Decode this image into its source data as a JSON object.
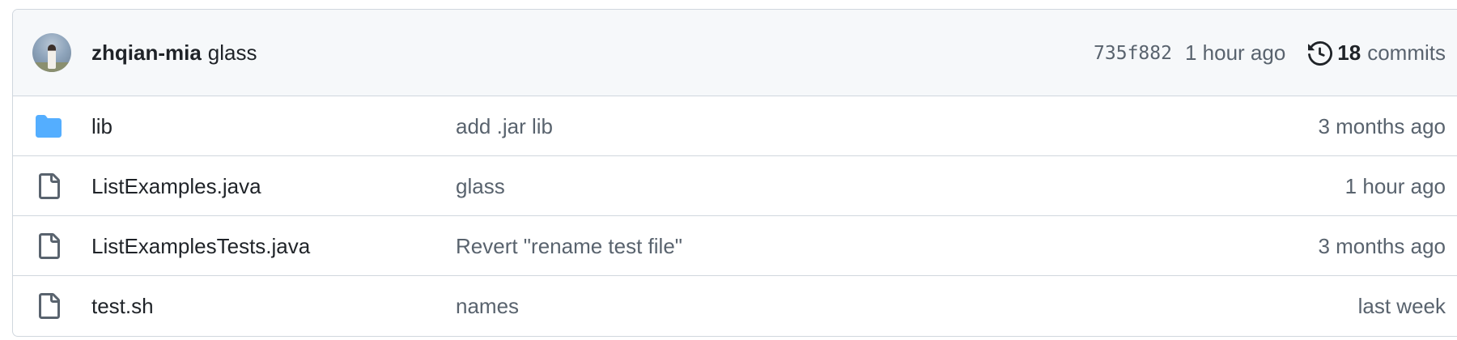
{
  "latest_commit": {
    "author": "zhqian-mia",
    "message": "glass",
    "sha": "735f882",
    "time": "1 hour ago",
    "commit_count": "18",
    "commits_label": "commits"
  },
  "files": [
    {
      "type": "folder",
      "icon": "folder-icon",
      "name": "lib",
      "message": "add .jar lib",
      "age": "3 months ago"
    },
    {
      "type": "file",
      "icon": "file-icon",
      "name": "ListExamples.java",
      "message": "glass",
      "age": "1 hour ago"
    },
    {
      "type": "file",
      "icon": "file-icon",
      "name": "ListExamplesTests.java",
      "message": "Revert \"rename test file\"",
      "age": "3 months ago"
    },
    {
      "type": "file",
      "icon": "file-icon",
      "name": "test.sh",
      "message": "names",
      "age": "last week"
    }
  ],
  "colors": {
    "folder": "#54aeff",
    "header_bg": "#f6f8fa",
    "border": "#d0d7de",
    "muted_text": "#59636e"
  }
}
